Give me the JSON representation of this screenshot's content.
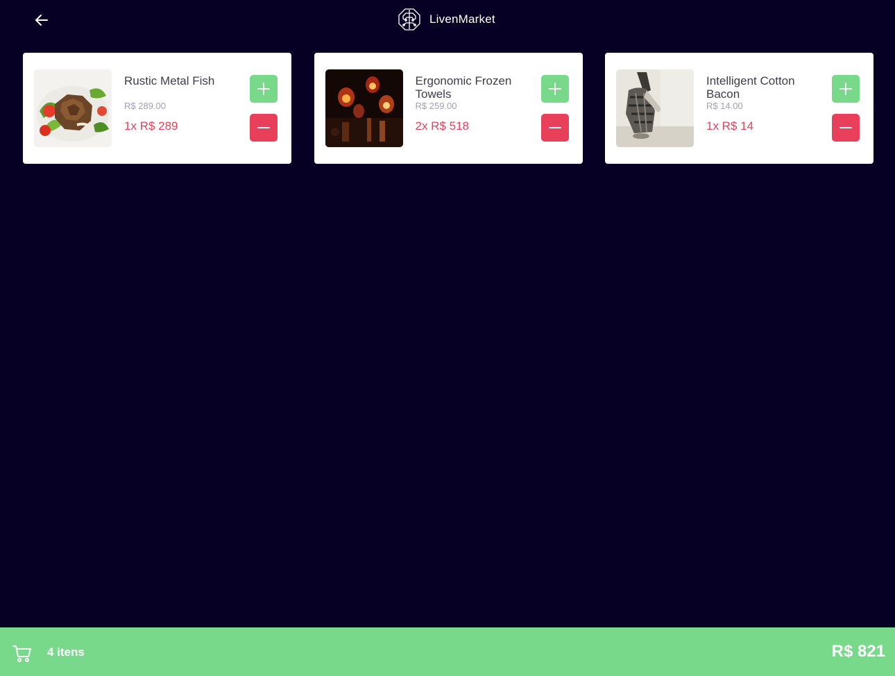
{
  "header": {
    "title": "LivenMarket",
    "back_icon": "arrow-left-icon",
    "logo_icon": "brain-logo-icon"
  },
  "products": [
    {
      "name": "Rustic Metal Fish",
      "price": "R$ 289.00",
      "subtotal": "1x R$ 289",
      "image": "salad-food-photo"
    },
    {
      "name": "Ergonomic Frozen Towels",
      "price": "R$ 259.00",
      "subtotal": "2x R$ 518",
      "image": "red-lamps-photo"
    },
    {
      "name": "Intelligent Cotton Bacon",
      "price": "R$ 14.00",
      "subtotal": "1x R$ 14",
      "image": "seated-person-photo"
    }
  ],
  "footer": {
    "cart_icon": "shopping-cart-icon",
    "items_label": "4 itens",
    "total": "R$ 821"
  },
  "colors": {
    "background": "#060124",
    "accent_green": "#78d98b",
    "accent_red": "#e83f5b",
    "card": "#ffffff"
  }
}
